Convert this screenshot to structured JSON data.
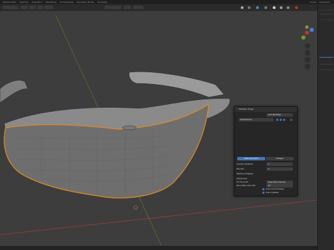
{
  "topbar": {
    "tabs": [
      "Texture Paint",
      "Shading",
      "Animation",
      "Rendering",
      "Compositing",
      "Geometry Nodes",
      "Scripting"
    ],
    "scene": "Scene",
    "view_layer": "ViewLayer"
  },
  "toolbar": {
    "mode": "Object Mode",
    "view_menu": "View",
    "select_menu": "Select",
    "add_menu": "Add",
    "object_menu": "Object",
    "global": "Global"
  },
  "panel": {
    "title": "Modifier Props",
    "add_modifier": "Add Modifier",
    "modifier_name": "Subdivision",
    "catmull_clark": "Catmull-Clark",
    "simple": "Simple",
    "levels_viewport_label": "Levels Viewport",
    "levels_viewport": "2",
    "render_label": "Render",
    "render": "2",
    "optimal_display": "Optimal Display",
    "advanced": "Advanced",
    "uv_smooth": "UV Smooth",
    "uv_smooth_value": "Keep Boundaries",
    "boundary_smooth": "Boundary Smooth",
    "boundary_smooth_value": "All",
    "use_limit_surface": "Use Limit Surface",
    "use_creases": "Use Creases",
    "use_custom_normals": "Use Custom Normals",
    "quality_label": "Quality",
    "quality": "3"
  },
  "colors": {
    "viewport_bg": "#3d3d3d",
    "selection_orange": "#e08a1e",
    "mesh_wire": "#2f2f2f",
    "mesh_fill": "#8a8a8a",
    "accent_blue": "#4574b3",
    "axis_red": "#9e3b3b",
    "axis_green": "#6b8b2e"
  }
}
